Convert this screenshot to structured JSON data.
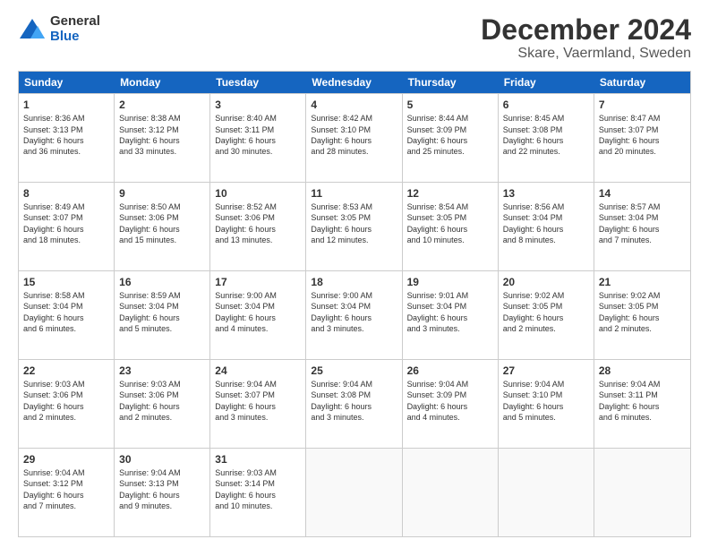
{
  "logo": {
    "general": "General",
    "blue": "Blue"
  },
  "title": "December 2024",
  "location": "Skare, Vaermland, Sweden",
  "header_days": [
    "Sunday",
    "Monday",
    "Tuesday",
    "Wednesday",
    "Thursday",
    "Friday",
    "Saturday"
  ],
  "rows": [
    [
      {
        "day": "1",
        "lines": [
          "Sunrise: 8:36 AM",
          "Sunset: 3:13 PM",
          "Daylight: 6 hours",
          "and 36 minutes."
        ]
      },
      {
        "day": "2",
        "lines": [
          "Sunrise: 8:38 AM",
          "Sunset: 3:12 PM",
          "Daylight: 6 hours",
          "and 33 minutes."
        ]
      },
      {
        "day": "3",
        "lines": [
          "Sunrise: 8:40 AM",
          "Sunset: 3:11 PM",
          "Daylight: 6 hours",
          "and 30 minutes."
        ]
      },
      {
        "day": "4",
        "lines": [
          "Sunrise: 8:42 AM",
          "Sunset: 3:10 PM",
          "Daylight: 6 hours",
          "and 28 minutes."
        ]
      },
      {
        "day": "5",
        "lines": [
          "Sunrise: 8:44 AM",
          "Sunset: 3:09 PM",
          "Daylight: 6 hours",
          "and 25 minutes."
        ]
      },
      {
        "day": "6",
        "lines": [
          "Sunrise: 8:45 AM",
          "Sunset: 3:08 PM",
          "Daylight: 6 hours",
          "and 22 minutes."
        ]
      },
      {
        "day": "7",
        "lines": [
          "Sunrise: 8:47 AM",
          "Sunset: 3:07 PM",
          "Daylight: 6 hours",
          "and 20 minutes."
        ]
      }
    ],
    [
      {
        "day": "8",
        "lines": [
          "Sunrise: 8:49 AM",
          "Sunset: 3:07 PM",
          "Daylight: 6 hours",
          "and 18 minutes."
        ]
      },
      {
        "day": "9",
        "lines": [
          "Sunrise: 8:50 AM",
          "Sunset: 3:06 PM",
          "Daylight: 6 hours",
          "and 15 minutes."
        ]
      },
      {
        "day": "10",
        "lines": [
          "Sunrise: 8:52 AM",
          "Sunset: 3:06 PM",
          "Daylight: 6 hours",
          "and 13 minutes."
        ]
      },
      {
        "day": "11",
        "lines": [
          "Sunrise: 8:53 AM",
          "Sunset: 3:05 PM",
          "Daylight: 6 hours",
          "and 12 minutes."
        ]
      },
      {
        "day": "12",
        "lines": [
          "Sunrise: 8:54 AM",
          "Sunset: 3:05 PM",
          "Daylight: 6 hours",
          "and 10 minutes."
        ]
      },
      {
        "day": "13",
        "lines": [
          "Sunrise: 8:56 AM",
          "Sunset: 3:04 PM",
          "Daylight: 6 hours",
          "and 8 minutes."
        ]
      },
      {
        "day": "14",
        "lines": [
          "Sunrise: 8:57 AM",
          "Sunset: 3:04 PM",
          "Daylight: 6 hours",
          "and 7 minutes."
        ]
      }
    ],
    [
      {
        "day": "15",
        "lines": [
          "Sunrise: 8:58 AM",
          "Sunset: 3:04 PM",
          "Daylight: 6 hours",
          "and 6 minutes."
        ]
      },
      {
        "day": "16",
        "lines": [
          "Sunrise: 8:59 AM",
          "Sunset: 3:04 PM",
          "Daylight: 6 hours",
          "and 5 minutes."
        ]
      },
      {
        "day": "17",
        "lines": [
          "Sunrise: 9:00 AM",
          "Sunset: 3:04 PM",
          "Daylight: 6 hours",
          "and 4 minutes."
        ]
      },
      {
        "day": "18",
        "lines": [
          "Sunrise: 9:00 AM",
          "Sunset: 3:04 PM",
          "Daylight: 6 hours",
          "and 3 minutes."
        ]
      },
      {
        "day": "19",
        "lines": [
          "Sunrise: 9:01 AM",
          "Sunset: 3:04 PM",
          "Daylight: 6 hours",
          "and 3 minutes."
        ]
      },
      {
        "day": "20",
        "lines": [
          "Sunrise: 9:02 AM",
          "Sunset: 3:05 PM",
          "Daylight: 6 hours",
          "and 2 minutes."
        ]
      },
      {
        "day": "21",
        "lines": [
          "Sunrise: 9:02 AM",
          "Sunset: 3:05 PM",
          "Daylight: 6 hours",
          "and 2 minutes."
        ]
      }
    ],
    [
      {
        "day": "22",
        "lines": [
          "Sunrise: 9:03 AM",
          "Sunset: 3:06 PM",
          "Daylight: 6 hours",
          "and 2 minutes."
        ]
      },
      {
        "day": "23",
        "lines": [
          "Sunrise: 9:03 AM",
          "Sunset: 3:06 PM",
          "Daylight: 6 hours",
          "and 2 minutes."
        ]
      },
      {
        "day": "24",
        "lines": [
          "Sunrise: 9:04 AM",
          "Sunset: 3:07 PM",
          "Daylight: 6 hours",
          "and 3 minutes."
        ]
      },
      {
        "day": "25",
        "lines": [
          "Sunrise: 9:04 AM",
          "Sunset: 3:08 PM",
          "Daylight: 6 hours",
          "and 3 minutes."
        ]
      },
      {
        "day": "26",
        "lines": [
          "Sunrise: 9:04 AM",
          "Sunset: 3:09 PM",
          "Daylight: 6 hours",
          "and 4 minutes."
        ]
      },
      {
        "day": "27",
        "lines": [
          "Sunrise: 9:04 AM",
          "Sunset: 3:10 PM",
          "Daylight: 6 hours",
          "and 5 minutes."
        ]
      },
      {
        "day": "28",
        "lines": [
          "Sunrise: 9:04 AM",
          "Sunset: 3:11 PM",
          "Daylight: 6 hours",
          "and 6 minutes."
        ]
      }
    ],
    [
      {
        "day": "29",
        "lines": [
          "Sunrise: 9:04 AM",
          "Sunset: 3:12 PM",
          "Daylight: 6 hours",
          "and 7 minutes."
        ]
      },
      {
        "day": "30",
        "lines": [
          "Sunrise: 9:04 AM",
          "Sunset: 3:13 PM",
          "Daylight: 6 hours",
          "and 9 minutes."
        ]
      },
      {
        "day": "31",
        "lines": [
          "Sunrise: 9:03 AM",
          "Sunset: 3:14 PM",
          "Daylight: 6 hours",
          "and 10 minutes."
        ]
      },
      {
        "day": "",
        "lines": []
      },
      {
        "day": "",
        "lines": []
      },
      {
        "day": "",
        "lines": []
      },
      {
        "day": "",
        "lines": []
      }
    ]
  ]
}
